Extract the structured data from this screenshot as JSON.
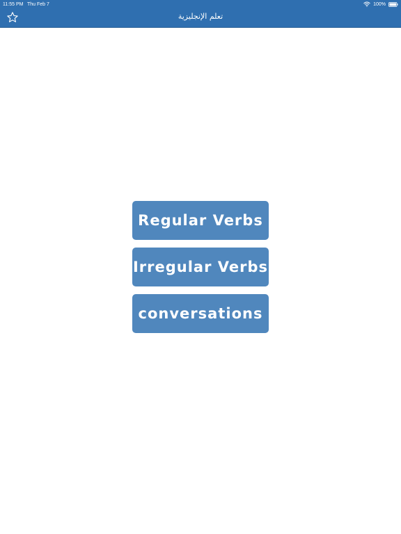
{
  "status_bar": {
    "time": "11:55 PM",
    "date": "Thu Feb 7",
    "battery": "100%"
  },
  "nav": {
    "title": "تعلم الإنجليزية",
    "favorite_icon": "star-outline-icon"
  },
  "menu": {
    "items": [
      {
        "label": "Regular Verbs"
      },
      {
        "label": "Irregular Verbs"
      },
      {
        "label": "conversations"
      }
    ]
  },
  "colors": {
    "nav_background": "#2f6fb0",
    "button_background": "#5087bd",
    "text_light": "#ffffff",
    "page_background": "#ffffff"
  }
}
